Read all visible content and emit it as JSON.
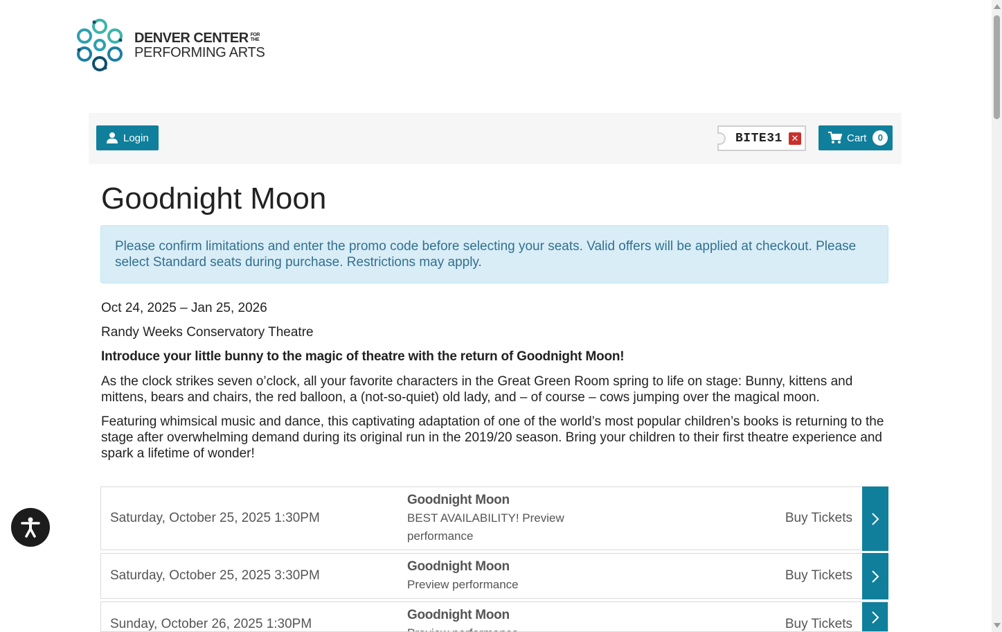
{
  "brand": {
    "line1": "DENVER CENTER",
    "for": "FOR",
    "the": "THE",
    "line2": "PERFORMING ARTS",
    "colors": [
      "#3fb4a9",
      "#1d7fa3",
      "#0f4f6b"
    ]
  },
  "toolbar": {
    "login_label": "Login",
    "login_icon": "user-icon",
    "promo_code": "BITE31",
    "promo_remove_icon": "close-icon",
    "cart_label": "Cart",
    "cart_count": "0",
    "cart_icon": "cart-icon",
    "accent_color": "#0f7f9c"
  },
  "event": {
    "title": "Goodnight Moon",
    "alert": "Please confirm limitations and enter the promo code before selecting your seats. Valid offers will be applied at checkout. Please select Standard seats during purchase. Restrictions may apply.",
    "dates": "Oct 24, 2025 – Jan 25, 2026",
    "venue": "Randy Weeks Conservatory Theatre",
    "intro": "Introduce your little bunny to the magic of theatre with the return of Goodnight Moon!",
    "paragraph1": "As the clock strikes seven o’clock, all your favorite characters in the Great Green Room spring to life on stage: Bunny, kittens and mittens, bears and chairs, the red balloon, a (not-so-quiet) old lady, and – of course – cows jumping over the magical moon.",
    "paragraph2": "Featuring whimsical music and dance, this captivating adaptation of one of the world’s most popular children’s books is returning to the stage after overwhelming demand during its original run in the 2019/20 season. Bring your children to their first theatre experience and spark a lifetime of wonder!"
  },
  "performances": [
    {
      "date": "Saturday, October 25, 2025 1:30PM",
      "show": "Goodnight Moon",
      "description": "BEST AVAILABILITY! Preview performance",
      "buy_label": "Buy Tickets"
    },
    {
      "date": "Saturday, October 25, 2025 3:30PM",
      "show": "Goodnight Moon",
      "description": "Preview performance",
      "buy_label": "Buy Tickets"
    },
    {
      "date": "Sunday, October 26, 2025 1:30PM",
      "show": "Goodnight Moon",
      "description": "Preview performance",
      "buy_label": "Buy Tickets"
    }
  ],
  "accessibility": {
    "icon": "accessibility-icon"
  }
}
